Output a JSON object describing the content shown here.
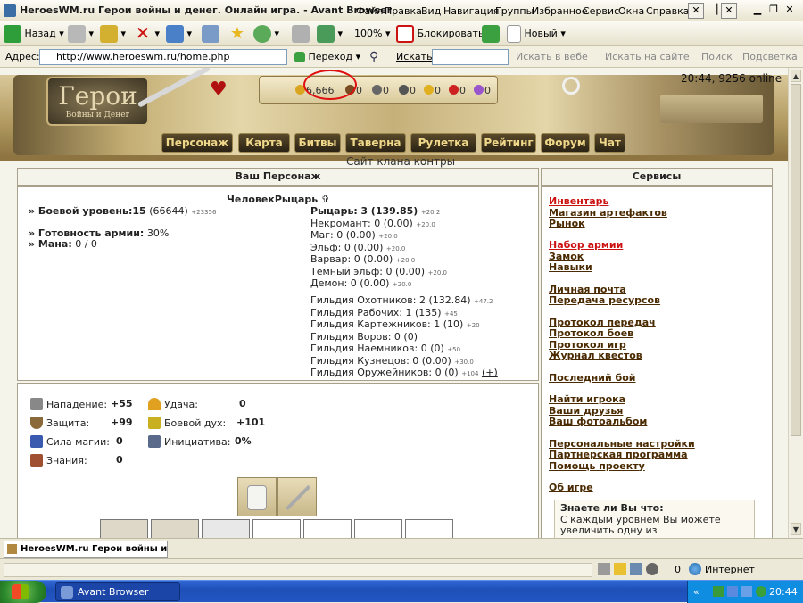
{
  "window": {
    "title": "HeroesWM.ru Герои войны и денег. Онлайн игра. - Avant Browser"
  },
  "menu": [
    "Файл",
    "Правка",
    "Вид",
    "Навигация",
    "Группы",
    "Избранное",
    "Сервис",
    "Окна",
    "Справка"
  ],
  "toolbar": {
    "back": "Назад",
    "zoom": "100%",
    "block": "Блокировать",
    "new": "Новый"
  },
  "address": {
    "label": "Адрес:",
    "url": "http://www.heroeswm.ru/home.php",
    "go": "Переход",
    "search_label": "Искать:",
    "search_value": "",
    "search_web": "Искать в вебе",
    "search_site": "Искать на сайте",
    "find": "Поиск",
    "highlight": "Подсветка"
  },
  "header": {
    "logo_title": "Герои",
    "logo_sub": "Войны и Денег",
    "resources": [
      {
        "value": "6,666",
        "icon": "gold-icon",
        "color": "#d9a520"
      },
      {
        "value": "0",
        "icon": "wood-icon",
        "color": "#7a4a20"
      },
      {
        "value": "0",
        "icon": "ore-icon",
        "color": "#666666"
      },
      {
        "value": "0",
        "icon": "mercury-icon",
        "color": "#555555"
      },
      {
        "value": "0",
        "icon": "sulfur-icon",
        "color": "#e0b020"
      },
      {
        "value": "0",
        "icon": "crystal-icon",
        "color": "#cc2222"
      },
      {
        "value": "0",
        "icon": "gems-icon",
        "color": "#9955cc"
      }
    ],
    "time_online": "20:44, 9256 online",
    "nav": [
      "Персонаж",
      "Карта",
      "Битвы",
      "Таверна",
      "Рулетка",
      "Рейтинг",
      "Форум",
      "Чат"
    ],
    "clan": "Сайт клана контры"
  },
  "character": {
    "panel_title": "Ваш Персонаж",
    "name": "ЧеловекРыцарь",
    "combat_level_label": "» Боевой уровень:",
    "combat_level": "15",
    "combat_exp": "(66644)",
    "combat_delta": "+23356",
    "army_ready_label": "» Готовность армии:",
    "army_ready": "30%",
    "mana_label": "» Мана:",
    "mana": "0 / 0",
    "factions": [
      {
        "name": "Рыцарь:",
        "value": "3 (139.85)",
        "delta": "+20.2"
      },
      {
        "name": "Некромант:",
        "value": "0 (0.00)",
        "delta": "+20.0"
      },
      {
        "name": "Маг:",
        "value": "0 (0.00)",
        "delta": "+20.0"
      },
      {
        "name": "Эльф:",
        "value": "0 (0.00)",
        "delta": "+20.0"
      },
      {
        "name": "Варвар:",
        "value": "0 (0.00)",
        "delta": "+20.0"
      },
      {
        "name": "Темный эльф:",
        "value": "0 (0.00)",
        "delta": "+20.0"
      },
      {
        "name": "Демон:",
        "value": "0 (0.00)",
        "delta": "+20.0"
      }
    ],
    "guilds": [
      {
        "name": "Гильдия Охотников:",
        "value": "2 (132.84)",
        "delta": "+47.2"
      },
      {
        "name": "Гильдия Рабочих:",
        "value": "1 (135)",
        "delta": "+45"
      },
      {
        "name": "Гильдия Картежников:",
        "value": "1 (10)",
        "delta": "+20"
      },
      {
        "name": "Гильдия Воров:",
        "value": "0 (0)",
        "delta": ""
      },
      {
        "name": "Гильдия Наемников:",
        "value": "0 (0)",
        "delta": "+50"
      },
      {
        "name": "Гильдия Кузнецов:",
        "value": "0 (0.00)",
        "delta": "+30.0"
      },
      {
        "name": "Гильдия Оружейников:",
        "value": "0 (0)",
        "delta": "+104"
      }
    ],
    "guild_plus": "(+)"
  },
  "stats": [
    {
      "label": "Нападение:",
      "value": "+55",
      "icon": "sword-icon",
      "color": "#888888"
    },
    {
      "label": "Удача:",
      "value": "0",
      "icon": "rainbow-icon",
      "color": "#e0a020"
    },
    {
      "label": "Защита:",
      "value": "+99",
      "icon": "shield-icon",
      "color": "#8a6a3a"
    },
    {
      "label": "Боевой дух:",
      "value": "+101",
      "icon": "wings-icon",
      "color": "#c8b020"
    },
    {
      "label": "Сила магии:",
      "value": "0",
      "icon": "wand-icon",
      "color": "#3a5ab0"
    },
    {
      "label": "Инициатива:",
      "value": "0%",
      "icon": "hourglass-icon",
      "color": "#5a6a8a"
    },
    {
      "label": "Знания:",
      "value": "0",
      "icon": "book-icon",
      "color": "#a05030"
    }
  ],
  "services": {
    "panel_title": "Сервисы",
    "links": [
      {
        "label": "Инвентарь",
        "red": true
      },
      {
        "label": "Магазин артефактов",
        "red": false
      },
      {
        "label": "Рынок",
        "red": false
      },
      {
        "label": "Набор армии",
        "red": true
      },
      {
        "label": "Замок",
        "red": false
      },
      {
        "label": "Навыки",
        "red": false
      },
      {
        "label": "Личная почта",
        "red": false
      },
      {
        "label": "Передача ресурсов",
        "red": false
      },
      {
        "label": "Протокол передач",
        "red": false
      },
      {
        "label": "Протокол боев",
        "red": false
      },
      {
        "label": "Протокол игр",
        "red": false
      },
      {
        "label": "Журнал квестов",
        "red": false
      },
      {
        "label": "Последний бой",
        "red": false
      },
      {
        "label": "Найти игрока",
        "red": false
      },
      {
        "label": "Ваши друзья",
        "red": false
      },
      {
        "label": "Ваш фотоальбом",
        "red": false
      },
      {
        "label": "Персональные настройки",
        "red": false
      },
      {
        "label": "Партнерская программа",
        "red": false
      },
      {
        "label": "Помощь проекту",
        "red": false
      },
      {
        "label": "Об игре",
        "red": false
      }
    ],
    "tip_title": "Знаете ли Вы что:",
    "tip_line1": "С каждым уровнем Вы можете",
    "tip_line2": "увеличить одну из"
  },
  "tab": {
    "label": "HeroesWM.ru Герои войны и де..."
  },
  "status": {
    "count": "0",
    "zone": "Интернет"
  },
  "taskbar": {
    "item": "Avant Browser",
    "clock": "20:44"
  }
}
